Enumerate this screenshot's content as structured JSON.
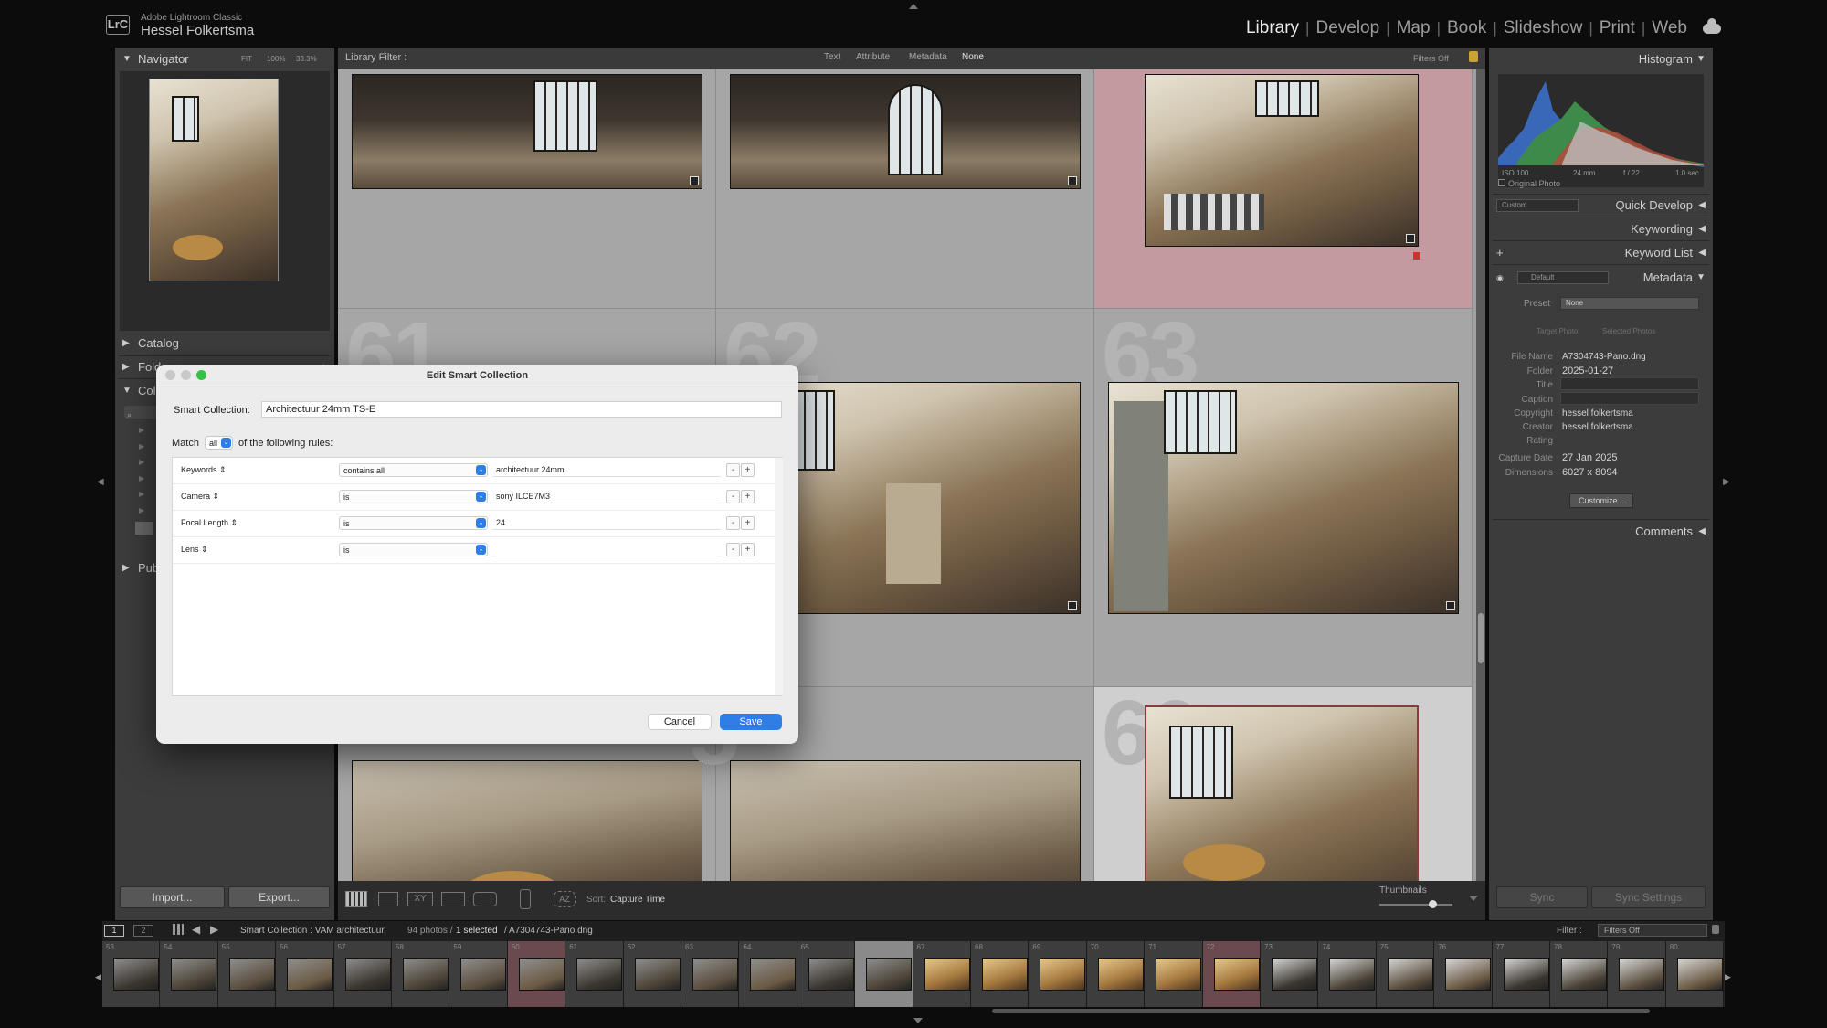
{
  "top_bar": {
    "logo_text": "LrC",
    "app_name": "Adobe Lightroom Classic",
    "user_name": "Hessel Folkertsma",
    "modules": [
      "Library",
      "Develop",
      "Map",
      "Book",
      "Slideshow",
      "Print",
      "Web"
    ],
    "active_module": "Library"
  },
  "left_panel": {
    "navigator": {
      "label": "Navigator",
      "zoom_options": [
        "FIT",
        "100%",
        "33.3%"
      ]
    },
    "catalog_label": "Catalog",
    "folders_label": "Folders",
    "collections_label": "Collections",
    "publish_label_partial": "Pub",
    "import_label": "Import...",
    "export_label": "Export..."
  },
  "filter_bar": {
    "label": "Library Filter :",
    "options": [
      "Text",
      "Attribute",
      "Metadata",
      "None"
    ],
    "active": "None",
    "filters_off": "Filters Off"
  },
  "grid": {
    "visible_numbers": [
      "61",
      "62",
      "63",
      "5",
      "66"
    ]
  },
  "dialog": {
    "title": "Edit Smart Collection",
    "name_label": "Smart Collection:",
    "name_value": "Architectuur 24mm TS-E",
    "match_prefix": "Match",
    "match_value": "all",
    "match_suffix": "of the following rules:",
    "rules": [
      {
        "field": "Keywords",
        "operator": "contains all",
        "value": "architectuur 24mm"
      },
      {
        "field": "Camera",
        "operator": "is",
        "value": "sony ILCE7M3"
      },
      {
        "field": "Focal Length",
        "operator": "is",
        "value": "24"
      },
      {
        "field": "Lens",
        "operator": "is",
        "value": ""
      }
    ],
    "cancel_label": "Cancel",
    "save_label": "Save"
  },
  "toolbar": {
    "sort_label": "Sort:",
    "sort_value": "Capture Time",
    "thumbnails_label": "Thumbnails"
  },
  "right_panel": {
    "histogram_label": "Histogram",
    "histogram_info": {
      "iso": "ISO 100",
      "focal": "24 mm",
      "aperture": "f / 22",
      "shutter": "1.0 sec"
    },
    "original_photo_label": "Original Photo",
    "quick_develop_label": "Quick Develop",
    "quick_develop_preset": "Custom",
    "keywording_label": "Keywording",
    "keyword_list_label": "Keyword List",
    "metadata_label": "Metadata",
    "metadata_preset_select": "Default",
    "preset_label": "Preset",
    "preset_value": "None",
    "target_photo": "Target Photo",
    "selected_photos": "Selected Photos",
    "fields": [
      {
        "label": "File Name",
        "value": "A7304743-Pano.dng"
      },
      {
        "label": "Folder",
        "value": "2025-01-27"
      },
      {
        "label": "Title",
        "value": ""
      },
      {
        "label": "Caption",
        "value": ""
      },
      {
        "label": "Copyright",
        "value": "hessel folkertsma"
      },
      {
        "label": "Creator",
        "value": "hessel folkertsma"
      },
      {
        "label": "Rating",
        "value": ""
      },
      {
        "label": "Capture Date",
        "value": "27 Jan 2025"
      },
      {
        "label": "Dimensions",
        "value": "6027 x 8094"
      }
    ],
    "customize_label": "Customize...",
    "comments_label": "Comments",
    "sync_label": "Sync",
    "sync_settings_label": "Sync Settings"
  },
  "filmstrip": {
    "view1": "1",
    "view2": "2",
    "source": "Smart Collection : VAM architectuur",
    "count": "94 photos /",
    "selected": "1 selected",
    "filename": "/ A7304743-Pano.dng",
    "filter_label": "Filter :",
    "filter_value": "Filters Off",
    "frames": [
      "53",
      "54",
      "55",
      "56",
      "57",
      "58",
      "59",
      "60",
      "61",
      "62",
      "63",
      "64",
      "65",
      "66",
      "67",
      "68",
      "69",
      "70",
      "71",
      "72",
      "73",
      "74",
      "75",
      "76",
      "77",
      "78",
      "79",
      "80"
    ]
  },
  "colors": {
    "accent_blue": "#2f7de6",
    "selected_cell": "#c39aa0",
    "panel_bg": "#3c3c3c"
  }
}
